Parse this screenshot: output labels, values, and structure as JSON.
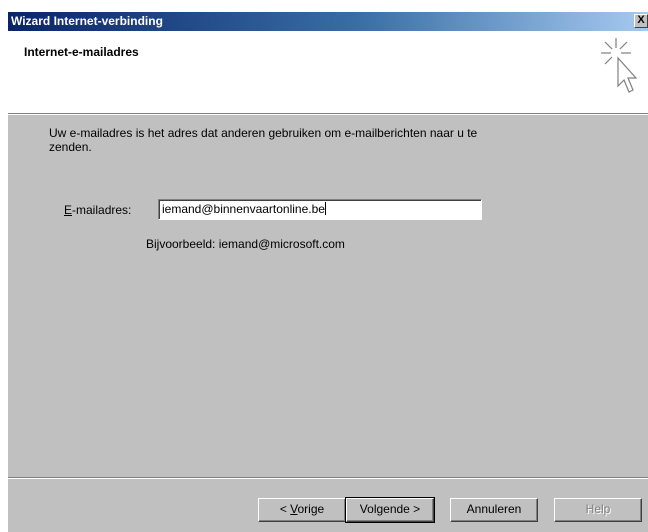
{
  "window": {
    "title": "Wizard Internet-verbinding",
    "close_label": "X"
  },
  "header": {
    "heading": "Internet-e-mailadres"
  },
  "body": {
    "intro": "Uw e-mailadres is het adres dat anderen gebruiken om e-mailberichten naar u te zenden.",
    "email_label_key": "E",
    "email_label_rest": "-mailadres:",
    "email_value": "iemand@binnenvaartonline.be",
    "example": "Bijvoorbeeld: iemand@microsoft.com"
  },
  "buttons": {
    "back_prefix": "< ",
    "back_key": "V",
    "back_rest": "orige",
    "next": "Volgende >",
    "cancel": "Annuleren",
    "help": "Help"
  },
  "colors": {
    "titlebar_start": "#0a246a",
    "titlebar_end": "#a6caf0",
    "face": "#c0c0c0"
  },
  "icons": {
    "header": "wizard-cursor-icon",
    "close": "close-icon"
  }
}
